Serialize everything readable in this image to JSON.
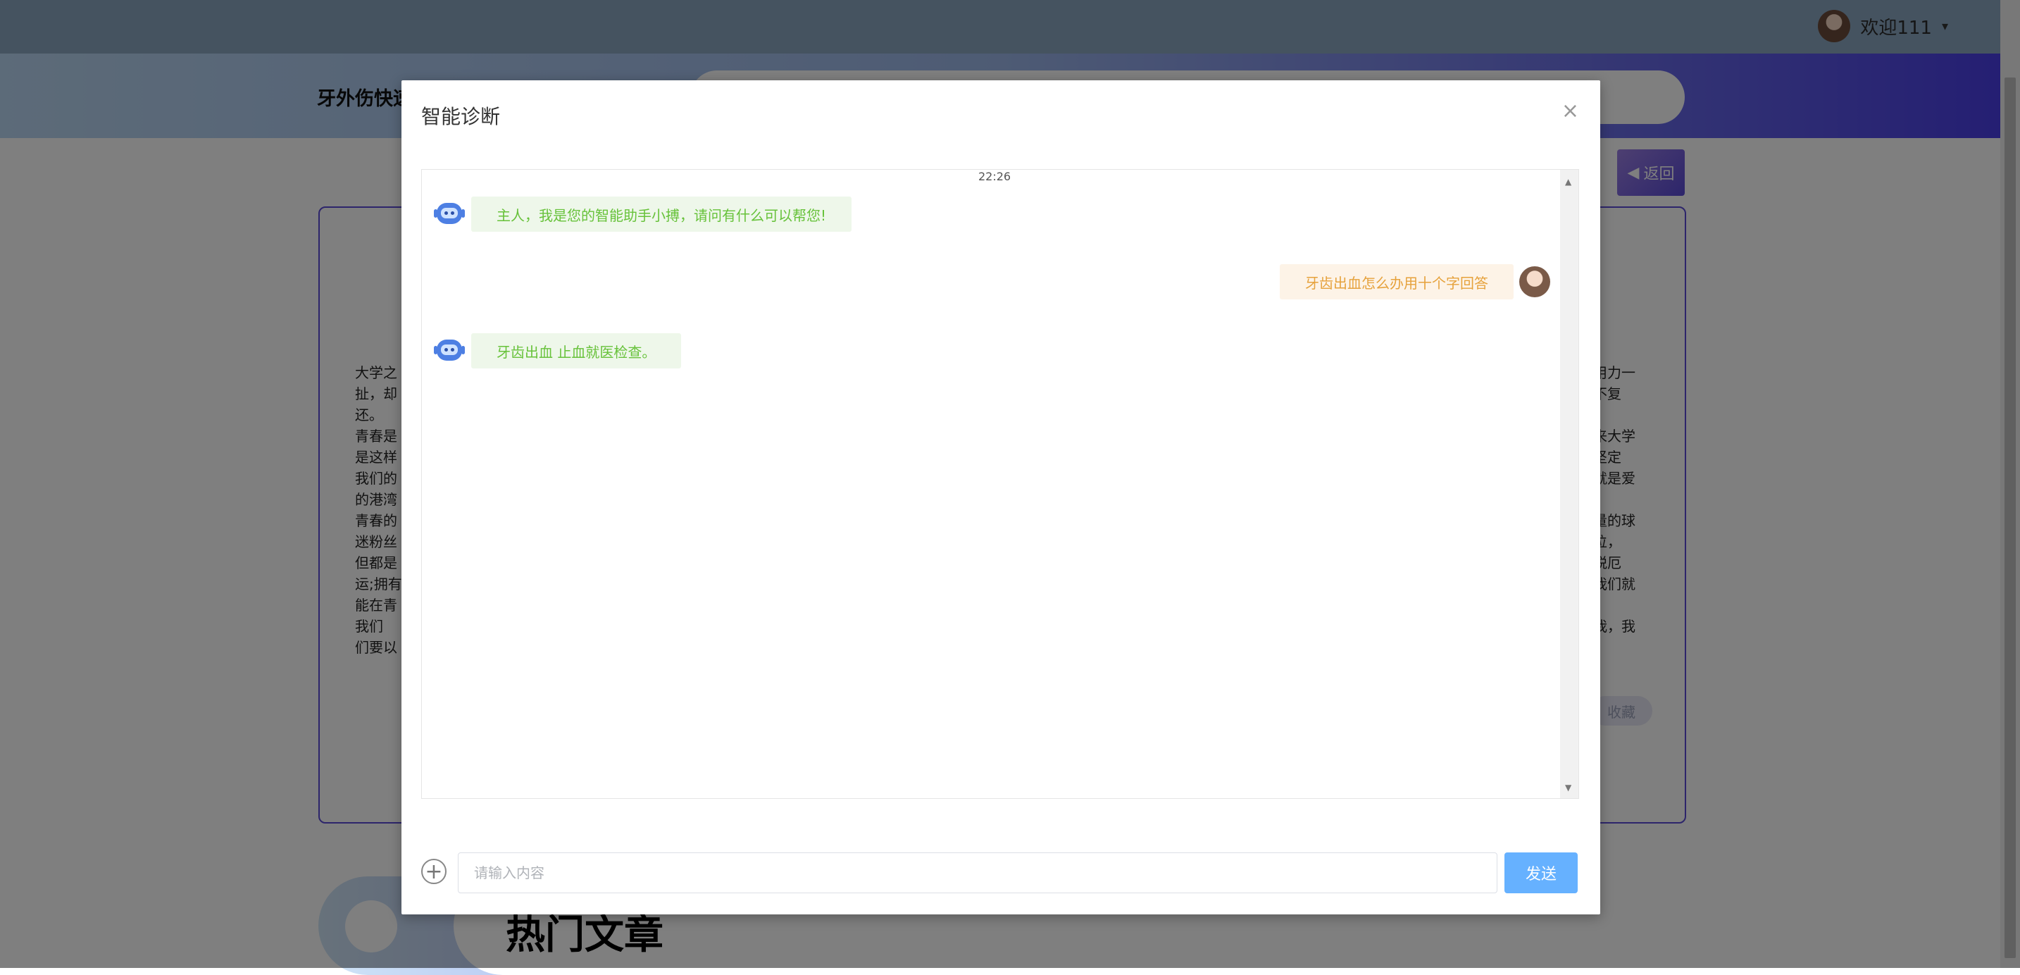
{
  "header": {
    "user_name": "欢迎111",
    "caret_glyph": "▾",
    "site_title": "牙外伤快速"
  },
  "page": {
    "back_label": "返回",
    "favorite_label": "收藏",
    "hot_title": "热门文章",
    "article_left_fragments": [
      "大学之",
      "扯，却",
      "还。",
      "青春是",
      "是这样",
      "我们的",
      "的港湾",
      "青春的",
      "迷粉丝",
      "但都是",
      "运;拥有",
      "能在青",
      "我们",
      "们要以"
    ],
    "article_right_fragments": [
      "用力一",
      "不复",
      "来大学",
      "坚定",
      "就是爱",
      "量的球",
      "位，",
      "脱厄",
      "我们就",
      "我，我"
    ]
  },
  "modal": {
    "title": "智能诊断",
    "close_glyph": "×",
    "timestamp": "22:26",
    "messages": [
      {
        "role": "bot",
        "text": "主人，我是您的智能助手小搏，请问有什么可以帮您!"
      },
      {
        "role": "user",
        "text": "牙齿出血怎么办用十个字回答"
      },
      {
        "role": "bot",
        "text": "牙齿出血 止血就医检查。"
      }
    ],
    "input": {
      "placeholder": "请输入内容",
      "value": ""
    },
    "send_label": "发送"
  },
  "colors": {
    "bot_bubble_bg": "#eef7ea",
    "bot_text": "#67c23a",
    "user_bubble_bg": "#fdf3e7",
    "user_text": "#e6a23c",
    "send_button": "#66b1ff",
    "accent_purple": "#5a4bd6"
  },
  "icons": {
    "plus": "plus-circle-icon",
    "bot": "robot-icon",
    "close": "close-icon",
    "back": "caret-left-icon"
  }
}
